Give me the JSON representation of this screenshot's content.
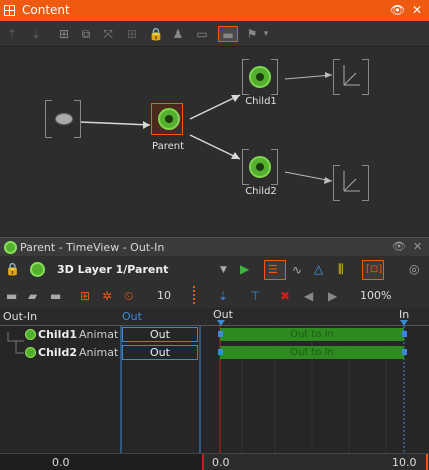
{
  "content_panel": {
    "title": "Content",
    "nodes": {
      "parent_label": "Parent",
      "child1_label": "Child1",
      "child2_label": "Child2"
    }
  },
  "timeview": {
    "title": "Parent - TimeView - Out-In",
    "layer_title": "3D Layer 1/Parent",
    "frame_value": "10",
    "zoom": "100%",
    "header": {
      "col_name": "Out-In",
      "col_value": "Out",
      "marker_out": "Out",
      "marker_in": "In"
    },
    "tracks": [
      {
        "name": "Child1",
        "type": "Animat",
        "value": "Out",
        "clip_label": "Out to In"
      },
      {
        "name": "Child2",
        "type": "Animat",
        "value": "Out",
        "clip_label": "Out to In"
      }
    ],
    "footer": {
      "left_time": "0.0",
      "range_start": "0.0",
      "range_end": "10.0"
    }
  },
  "colors": {
    "accent": "#ef5a13",
    "clip_green": "#2e8b20",
    "node_green": "#55b12d",
    "selection_blue": "#3c8ad6",
    "playhead_red": "#c0201c"
  }
}
